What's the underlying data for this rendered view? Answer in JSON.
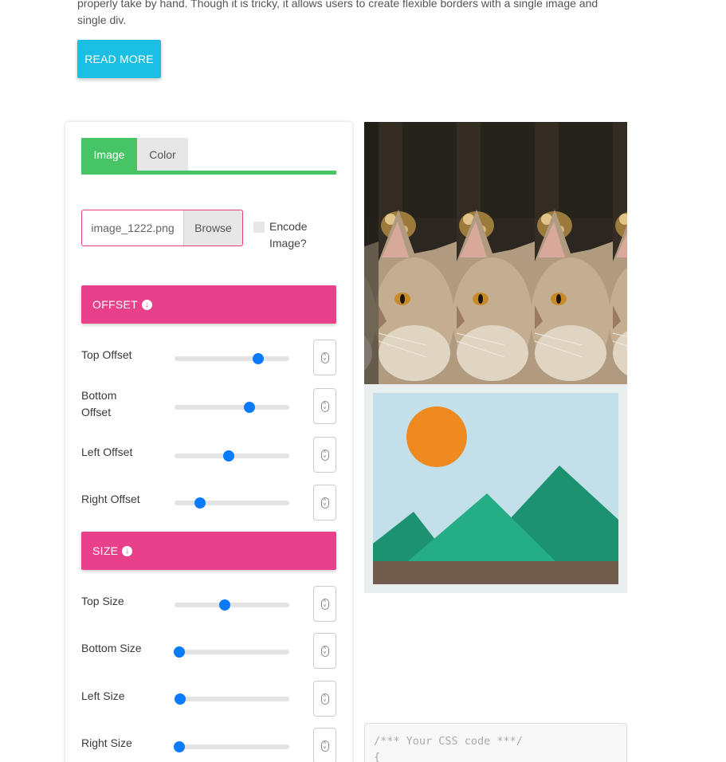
{
  "intro": {
    "text": "properly take by hand. Though it is tricky, it allows users to create flexible borders with a single image and single div."
  },
  "read_more": {
    "label": "READ MORE"
  },
  "tabs": [
    {
      "label": "Image",
      "active": true
    },
    {
      "label": "Color",
      "active": false
    }
  ],
  "file": {
    "name": "image_1222.png",
    "browse_label": "Browse",
    "encode_label": "Encode Image?",
    "encode_checked": false
  },
  "offset": {
    "header": "OFFSET",
    "rows": [
      {
        "label": "Top Offset",
        "value": 0.73
      },
      {
        "label": "Bottom Offset",
        "value": 0.65
      },
      {
        "label": "Left Offset",
        "value": 0.47
      },
      {
        "label": "Right Offset",
        "value": 0.22
      }
    ]
  },
  "size": {
    "header": "SIZE",
    "rows": [
      {
        "label": "Top Size",
        "value": 0.44
      },
      {
        "label": "Bottom Size",
        "value": 0.04
      },
      {
        "label": "Left Size",
        "value": 0.05
      },
      {
        "label": "Right Size",
        "value": 0.04
      }
    ]
  },
  "code": {
    "comment": "/*** Your CSS code ***/",
    "line2": "{"
  },
  "colors": {
    "accent_pink": "#e9408c",
    "tab_green": "#47c466",
    "read_more_blue": "#1bbfe4",
    "slider_blue": "#0a7bff"
  },
  "icons": {
    "section_arrow": "arrow-circle-down-icon",
    "stepper": "up-down-stepper-icon"
  }
}
